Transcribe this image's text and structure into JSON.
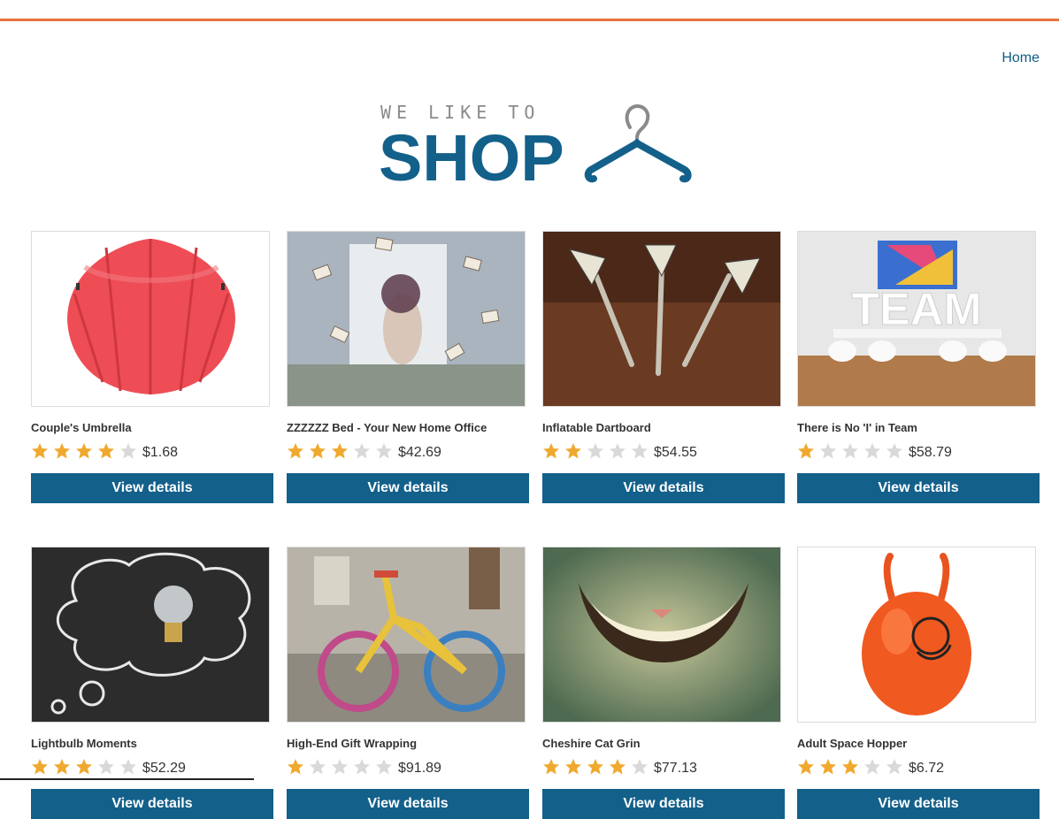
{
  "nav": {
    "home_label": "Home"
  },
  "logo": {
    "tagline": "WE LIKE TO",
    "wordmark": "SHOP",
    "icon": "hanger-icon",
    "color": "#13608a"
  },
  "colors": {
    "accent": "#e8733f",
    "brand": "#13608a",
    "star_on": "#f0a92f",
    "star_off": "#d9d9d9"
  },
  "products": [
    {
      "name": "Couple's Umbrella",
      "price": "$1.68",
      "rating": 4,
      "button": "View details"
    },
    {
      "name": "ZZZZZZ Bed - Your New Home Office",
      "price": "$42.69",
      "rating": 3,
      "button": "View details"
    },
    {
      "name": "Inflatable Dartboard",
      "price": "$54.55",
      "rating": 2,
      "button": "View details"
    },
    {
      "name": "There is No 'I' in Team",
      "price": "$58.79",
      "rating": 1,
      "button": "View details"
    },
    {
      "name": "Lightbulb Moments",
      "price": "$52.29",
      "rating": 3,
      "button": "View details"
    },
    {
      "name": "High-End Gift Wrapping",
      "price": "$91.89",
      "rating": 1,
      "button": "View details"
    },
    {
      "name": "Cheshire Cat Grin",
      "price": "$77.13",
      "rating": 4,
      "button": "View details"
    },
    {
      "name": "Adult Space Hopper",
      "price": "$6.72",
      "rating": 3,
      "button": "View details"
    }
  ]
}
